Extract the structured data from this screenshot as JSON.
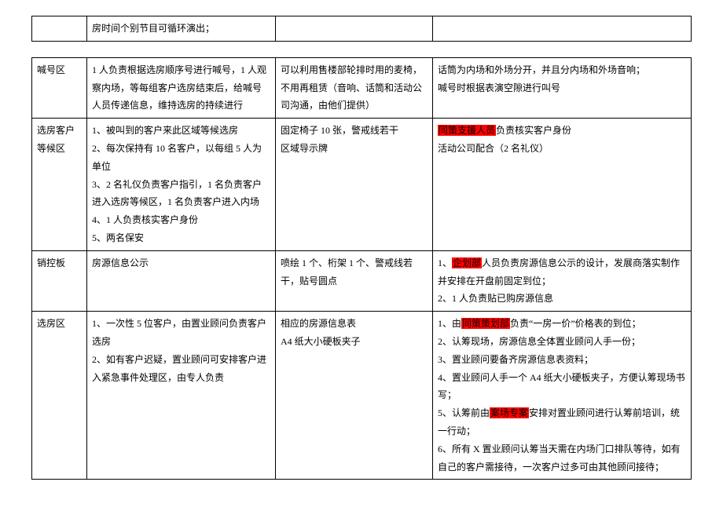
{
  "table1": {
    "row1": {
      "col1": "",
      "col2": "房时间个别节目可循环演出；",
      "col3": "",
      "col4": ""
    }
  },
  "table2": {
    "rows": [
      {
        "col1": "喊号区",
        "col2_lines": [
          "1 人负责根据选房顺序号进行喊号，1 人观察内场，等每组客户选房结束后，给喊号人员传递信息，维持选房的持续进行"
        ],
        "col3_lines": [
          "可以利用售楼部轮排时用的麦椅，不用再租赁（音响、话筒和活动公司沟通，由他们提供）"
        ],
        "col4_lines": [
          "话筒为内场和外场分开，并且分内场和外场音响；",
          "喊号时根据表演空隙进行叫号"
        ]
      },
      {
        "col1": "选房客户等候区",
        "col2_lines": [
          "1、被叫到的客户来此区域等候选房",
          "2、每次保持有 10 名客户，以每组 5 人为单位",
          "3、2 名礼仪负责客户指引，1 名负责客户进入选房等候区，1 名负责客户进入内场",
          "4、1 人负责核实客户身份",
          "5、两名保安"
        ],
        "col3_lines": [
          "固定椅子 10 张，警戒线若干",
          "区域导示牌"
        ],
        "col4_parts": [
          {
            "type": "hl",
            "text": "同策支援人员"
          },
          {
            "type": "plain",
            "text": "负责核实客户身份"
          },
          {
            "type": "break"
          },
          {
            "type": "plain",
            "text": "活动公司配合（2 名礼仪）"
          }
        ]
      },
      {
        "col1": "销控板",
        "col2_lines": [
          "房源信息公示"
        ],
        "col3_lines": [
          "喷绘 1 个、桁架 1 个、警戒线若干，贴号圆点"
        ],
        "col4_parts": [
          {
            "type": "plain",
            "text": "1、"
          },
          {
            "type": "hl",
            "text": "企划部"
          },
          {
            "type": "plain",
            "text": "人员负责房源信息公示的设计，发展商落实制作并安排在开盘前固定到位；"
          },
          {
            "type": "break"
          },
          {
            "type": "plain",
            "text": "2、1 人负责贴已购房源信息"
          }
        ]
      },
      {
        "col1": "选房区",
        "col2_lines": [
          "1、一次性 5 位客户，由置业顾问负责客户选房",
          "2、如有客户迟疑，置业顾问可安排客户进入紧急事件处理区，由专人负责"
        ],
        "col3_lines": [
          "相应的房源信息表",
          "A4 纸大小硬板夹子"
        ],
        "col4_parts": [
          {
            "type": "plain",
            "text": "1、由"
          },
          {
            "type": "hl",
            "text": "同策策划部"
          },
          {
            "type": "plain",
            "text": "负责“一房一价”价格表的到位；"
          },
          {
            "type": "break"
          },
          {
            "type": "plain",
            "text": "2、认筹现场，房源信息全体置业顾问人手一份；"
          },
          {
            "type": "break"
          },
          {
            "type": "plain",
            "text": "3、置业顾问要备齐房源信息表资料；"
          },
          {
            "type": "break"
          },
          {
            "type": "plain",
            "text": "4、置业顾问人手一个 A4 纸大小硬板夹子，方便认筹现场书写；"
          },
          {
            "type": "break"
          },
          {
            "type": "plain",
            "text": "5、认筹前由"
          },
          {
            "type": "hl",
            "text": "案场专案"
          },
          {
            "type": "plain",
            "text": "安排对置业顾问进行认筹前培训，统一行动；"
          },
          {
            "type": "break"
          },
          {
            "type": "plain",
            "text": "6、所有 X 置业顾问认筹当天需在内场门口排队等待，如有自己的客户需接待，一次客户过多可由其他顾问接待；"
          }
        ]
      }
    ]
  }
}
